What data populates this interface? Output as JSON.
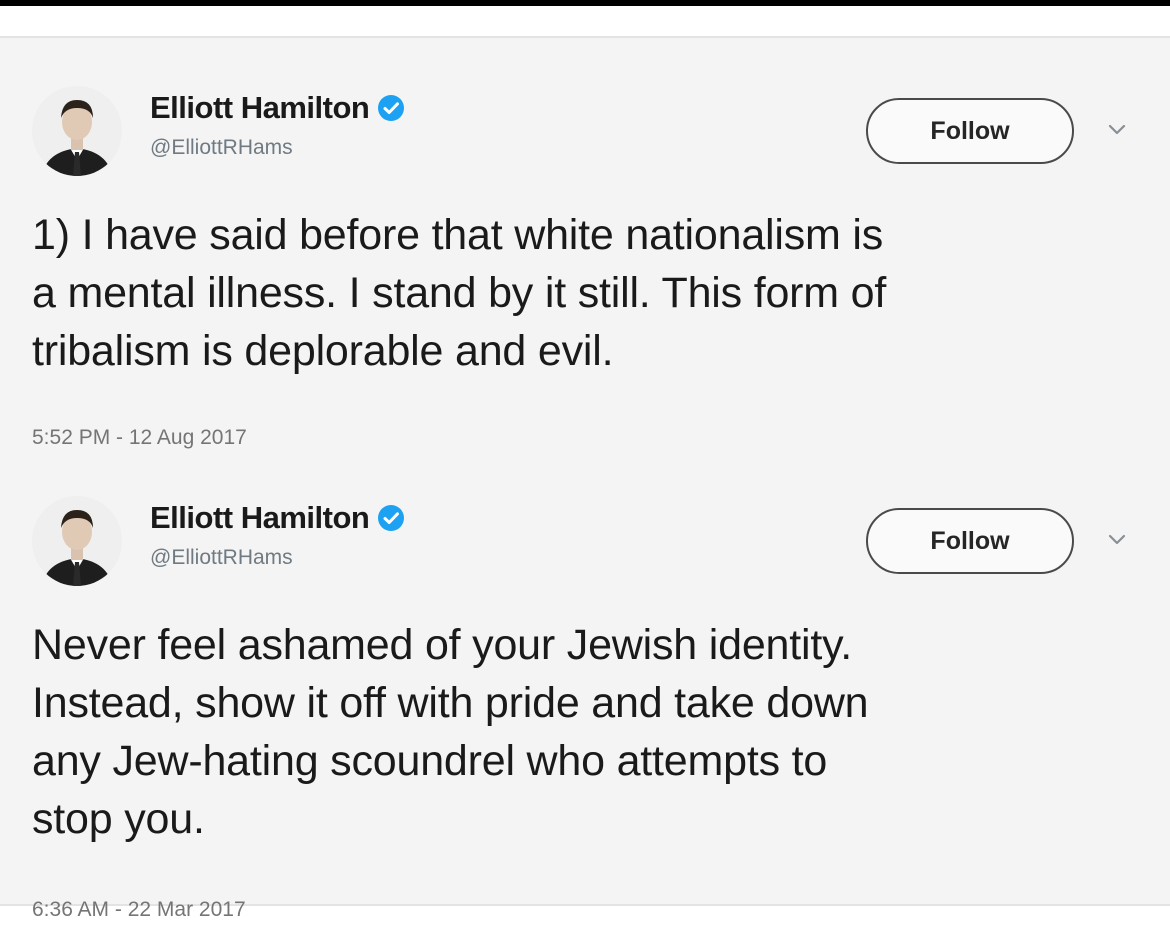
{
  "tweets": [
    {
      "author": {
        "name": "Elliott Hamilton",
        "handle": "@ElliottRHams"
      },
      "follow_label": "Follow",
      "text": "1) I have said before that white nationalism is\na mental illness. I stand by it still. This form of\ntribalism is deplorable and evil.",
      "timestamp": "5:52 PM - 12 Aug 2017"
    },
    {
      "author": {
        "name": "Elliott Hamilton",
        "handle": "@ElliottRHams"
      },
      "follow_label": "Follow",
      "text": "Never feel ashamed of your Jewish identity.\nInstead, show it off with pride and take down\nany Jew-hating scoundrel who attempts to\nstop you.",
      "timestamp": "6:36 AM - 22 Mar 2017"
    }
  ],
  "icons": {
    "verified": "verified-badge-icon",
    "chevron": "chevron-down-icon",
    "avatar": "profile-photo"
  },
  "colors": {
    "verified": "#1da1f2",
    "card_bg": "#f4f4f4",
    "muted_text": "#757575"
  }
}
